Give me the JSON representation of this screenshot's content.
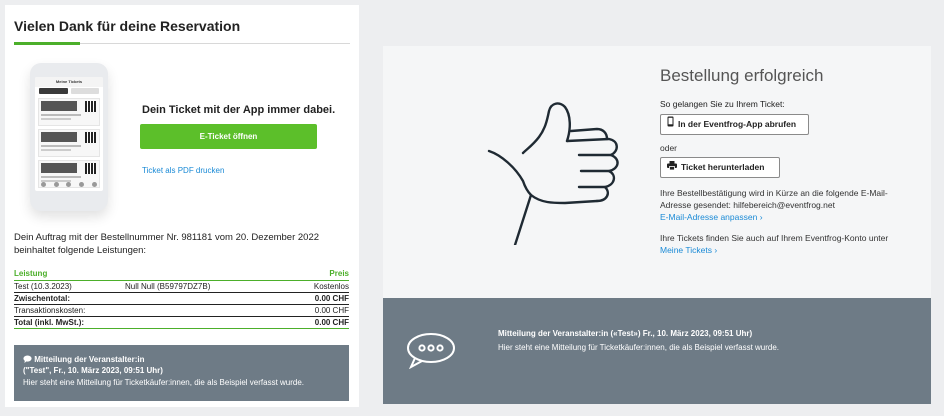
{
  "left": {
    "title": "Vielen Dank für deine Reservation",
    "phone": {
      "header": "Meine Tickets"
    },
    "app_text": "Dein Ticket mit der App immer dabei.",
    "open_button": "E-Ticket öffnen",
    "pdf_link": "Ticket als PDF drucken",
    "order_text": "Dein Auftrag mit der Bestellnummer Nr. 981181 vom 20. Dezember 2022 beinhaltet folgende Leistungen:",
    "table": {
      "header": {
        "col1": "Leistung",
        "col3": "Preis"
      },
      "item": {
        "col1": "Test (10.3.2023)",
        "col2": "Null Null (B59797DZ7B)",
        "col3": "Kostenlos"
      },
      "subtotal": {
        "label": "Zwischentotal:",
        "value": "0.00 CHF"
      },
      "fees": {
        "label": "Transaktionskosten:",
        "value": "0.00 CHF"
      },
      "total": {
        "label": "Total (inkl. MwSt.):",
        "value": "0.00 CHF"
      }
    },
    "message": {
      "line1": "Mitteilung der Veranstalter:in",
      "line2": "(\"Test\", Fr., 10. März 2023, 09:51 Uhr)",
      "line3": "Hier steht eine Mitteilung für Ticketkäufer:innen, die als Beispiel verfasst wurde."
    }
  },
  "right": {
    "title": "Bestellung erfolgreich",
    "subtitle": "So gelangen Sie zu Ihrem Ticket:",
    "app_button": "In der Eventfrog-App abrufen",
    "or_text": "oder",
    "download_button": "Ticket herunterladen",
    "confirm_text_1": "Ihre Bestellbestätigung wird in Kürze an die folgende E-Mail-",
    "confirm_text_2": "Adresse gesendet: hilfebereich@eventfrog.net",
    "change_email_link": "E-Mail-Adresse anpassen",
    "account_text": "Ihre Tickets finden Sie auch auf Ihrem Eventfrog-Konto unter",
    "my_tickets_link": "Meine Tickets",
    "message": {
      "line1": "Mitteilung der Veranstalter:in («Test») Fr., 10. März 2023, 09:51 Uhr)",
      "line2": "Hier steht eine Mitteilung für Ticketkäufer:innen, die als Beispiel verfasst wurde."
    }
  },
  "icons": {
    "phone_icon": "smartphone-icon",
    "download_icon": "printer-icon",
    "thumb_icon": "thumbs-up-icon",
    "chat_icon": "speech-bubble-icon",
    "chevron": "›"
  },
  "colors": {
    "accent": "#5cbf2a",
    "link": "#1a8ad6",
    "message_bg": "#6e7b86"
  }
}
